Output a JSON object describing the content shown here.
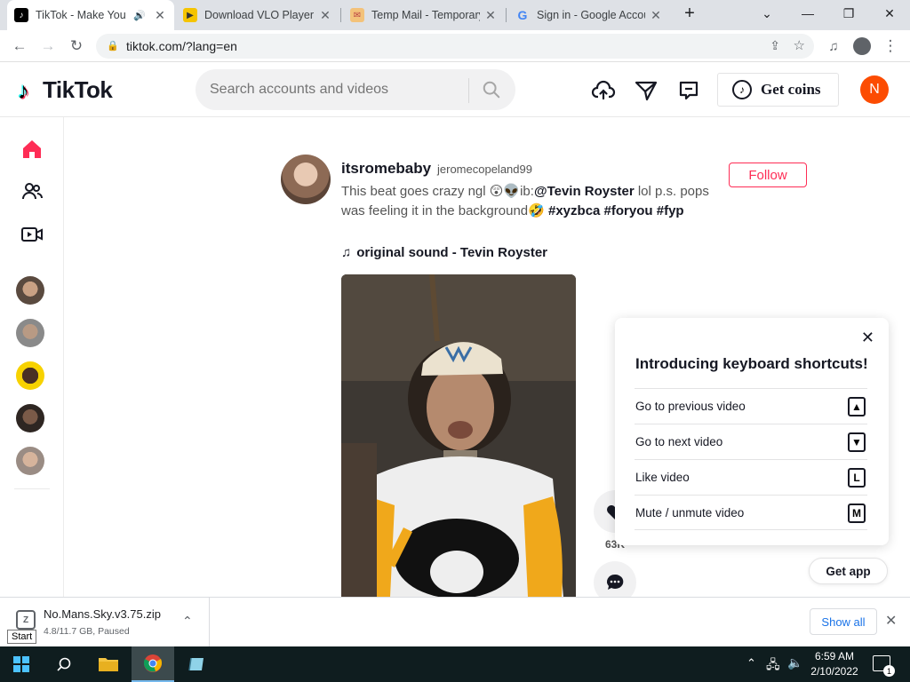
{
  "browser": {
    "tabs": [
      {
        "title": "TikTok - Make You",
        "favicon": "tiktok-icon",
        "active": true,
        "audio": true
      },
      {
        "title": "Download VLO Player",
        "favicon": "vlo-icon",
        "active": false
      },
      {
        "title": "Temp Mail - Temporary",
        "favicon": "tempmail-icon",
        "active": false
      },
      {
        "title": "Sign in - Google Accou",
        "favicon": "google-icon",
        "active": false
      }
    ],
    "new_tab_symbol": "+",
    "url": "tiktok.com/?lang=en"
  },
  "tiktok": {
    "logo_text": "TikTok",
    "search_placeholder": "Search accounts and videos",
    "get_coins_label": "Get coins",
    "avatar_initial": "N",
    "colors": {
      "brand_red": "#fe2c55",
      "avatar_bg": "#fc4c02"
    }
  },
  "post": {
    "username": "itsromebaby",
    "handle": "jeromecopeland99",
    "caption_text": "This beat goes crazy ngl",
    "caption_emojis_1": "😲👽",
    "caption_ib": "ib:",
    "caption_mention": "@Tevin Royster",
    "caption_text_2": " lol p.s. pops was feeling it in the background",
    "caption_emoji_2": "🤣",
    "hashtags": [
      "#xyzbca",
      "#foryou",
      "#fyp"
    ],
    "sound": "original sound - Tevin Royster",
    "follow_label": "Follow",
    "like_count": "63K"
  },
  "shortcuts": {
    "title": "Introducing keyboard shortcuts!",
    "items": [
      {
        "label": "Go to previous video",
        "key": "▲"
      },
      {
        "label": "Go to next video",
        "key": "▼"
      },
      {
        "label": "Like video",
        "key": "L"
      },
      {
        "label": "Mute / unmute video",
        "key": "M"
      }
    ]
  },
  "get_app_label": "Get app",
  "download": {
    "filename": "No.Mans.Sky.v3.75.zip",
    "status": "4.8/11.7 GB, Paused",
    "show_all_label": "Show all",
    "start_tooltip": "Start"
  },
  "taskbar": {
    "time": "6:59 AM",
    "date": "2/10/2022",
    "notification_count": "1"
  }
}
